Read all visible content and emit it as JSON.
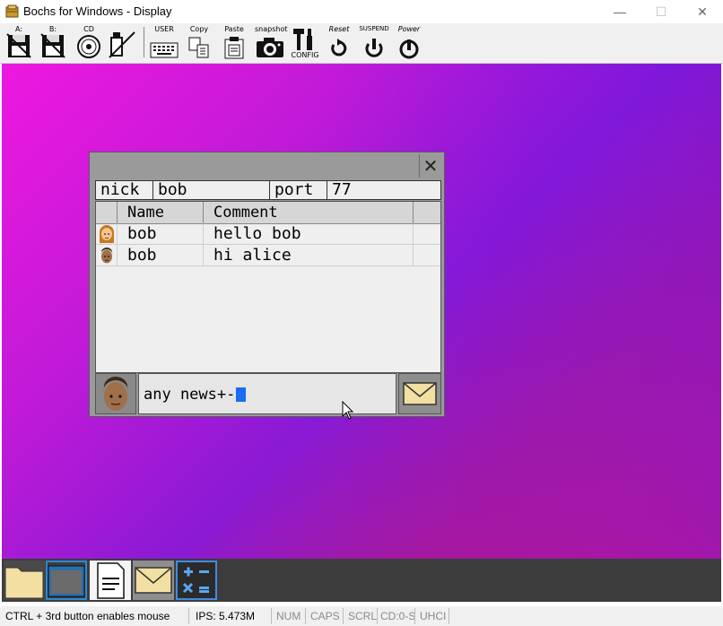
{
  "window": {
    "title": "Bochs for Windows - Display",
    "min_glyph": "—",
    "max_glyph": "☐",
    "close_glyph": "✕"
  },
  "toolbar": {
    "floppy_a": "A:",
    "floppy_b": "B:",
    "cd": "CD",
    "user": "USER",
    "copy": "Copy",
    "paste": "Paste",
    "snapshot": "snapshot",
    "config": "CONFIG",
    "reset": "Reset",
    "suspend": "SUSPEND",
    "power": "Power"
  },
  "chat": {
    "close_glyph": "✕",
    "nick_label": "nick",
    "nick_value": "bob",
    "port_label": "port",
    "port_value": "77",
    "col_name": "Name",
    "col_comment": "Comment",
    "rows": [
      {
        "name": "bob",
        "comment": "hello bob",
        "avatar": "female-avatar-icon"
      },
      {
        "name": "bob",
        "comment": "hi alice",
        "avatar": "male-avatar-icon"
      }
    ],
    "input_value": "any news+-"
  },
  "taskbar": {
    "items": [
      "folder-icon",
      "window-icon",
      "document-icon",
      "mail-icon",
      "calculator-icon"
    ]
  },
  "statusbar": {
    "hint": "CTRL + 3rd button enables mouse",
    "ips": "IPS: 5.473M",
    "num": "NUM",
    "caps": "CAPS",
    "scrl": "SCRL",
    "cd": "CD:0-S",
    "usb": "UHCI"
  },
  "colors": {
    "accent_caret": "#1a6cf0",
    "desktop_top": "#ee18e0",
    "desktop_bottom": "#e01a66"
  }
}
